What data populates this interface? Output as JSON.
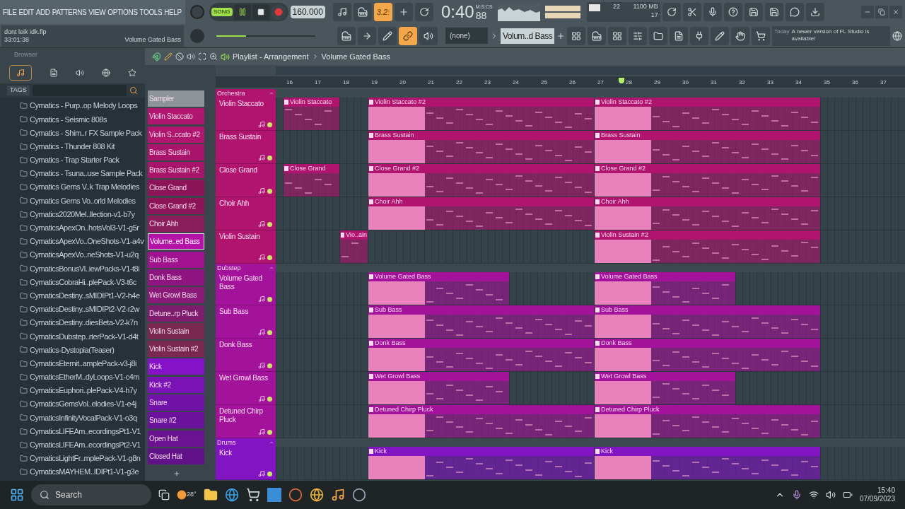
{
  "menu": [
    "FILE",
    "EDIT",
    "ADD",
    "PATTERNS",
    "VIEW",
    "OPTIONS",
    "TOOLS",
    "HELP"
  ],
  "project": {
    "file": "dont leik idk.flp",
    "duration": "33:01:38",
    "hint": "Volume Gated Bass"
  },
  "transport": {
    "mode_label": "SONG",
    "song_mode": true,
    "playing": true,
    "tempo": "160.000",
    "time": "0:40",
    "time_cs": "88",
    "time_unit": "M:S:CS"
  },
  "pitch_slider": {
    "level": 0.3
  },
  "countdown": {
    "label": "3.2:",
    "on": true
  },
  "link": {
    "on": true
  },
  "cpu": {
    "voices": "22",
    "memory": "1100 MB",
    "polyphony": "17"
  },
  "pattern": {
    "preset": "(none)",
    "name": "Volum..d Bass"
  },
  "news": {
    "when": "Today",
    "text": "A newer version of FL Studio is available!"
  },
  "browser": {
    "title": "Browser",
    "tags_label": "TAGS",
    "items": [
      "Cymatics - Purp..op Melody Loops",
      "Cymatics - Seismic 808s",
      "Cymatics - Shim..r FX Sample Pack",
      "Cymatics - Thunder 808 Kit",
      "Cymatics - Trap Starter Pack",
      "Cymatics - Tsuna..use Sample Pack",
      "Cymatics Gems V..k Trap Melodies",
      "Cymatics Gems Vo..orld Melodies",
      "Cymatics2020Mel..llection-v1-b7y",
      "CymaticsApexOn..hotsVol3-V1-g5r",
      "CymaticsApexVo..OneShots-V1-a4v",
      "CymaticsApexVo..neShots-V1-u2q",
      "CymaticsBonusVl..iewPacks-V1-t8i",
      "CymaticsCobraHi..plePack-V3-t6c",
      "CymaticsDestiny..sMIDIPt1-V2-h4e",
      "CymaticsDestiny..sMIDIPt2-V2-r2w",
      "CymaticsDestiny..diesBeta-V2-k7n",
      "CymaticsDubstep..rterPack-V1-d4t",
      "Cymatics-Dystopia(Teaser)",
      "CymaticsEternit..amplePack-v3-j8i",
      "CymaticsEtherM..dyLoops-V1-c4m",
      "CymaticsEuphori..plePack-V4-h7y",
      "CymaticsGemsVol..elodies-V1-e4j",
      "CymaticsInfinityVocalPack-V1-o3q",
      "CymaticsLIFEAm..ecordingsPt1-V1",
      "CymaticsLIFEAm..ecordingsPt2-V1",
      "CymaticsLightFr..mplePack-V1-g8n",
      "CymaticsMAYHEM..IDIPt1-V1-g3e"
    ]
  },
  "channels": [
    {
      "name": "Sampler",
      "color": "#8e9599",
      "selected": false
    },
    {
      "name": "Violin Staccato",
      "color": "#b0156f",
      "selected": false
    },
    {
      "name": "Violin S..ccato #2",
      "color": "#b0156f",
      "selected": false
    },
    {
      "name": "Brass Sustain",
      "color": "#a8146a",
      "selected": false
    },
    {
      "name": "Brass Sustain #2",
      "color": "#a8146a",
      "selected": false
    },
    {
      "name": "Close Grand",
      "color": "#8e1459",
      "selected": false
    },
    {
      "name": "Close Grand #2",
      "color": "#8e1459",
      "selected": false
    },
    {
      "name": "Choir Ahh",
      "color": "#8a1d5c",
      "selected": false
    },
    {
      "name": "Volume..ed Bass",
      "color": "#b512a8",
      "selected": true
    },
    {
      "name": "Sub Bass",
      "color": "#a0128f",
      "selected": false
    },
    {
      "name": "Donk Bass",
      "color": "#8e1480",
      "selected": false
    },
    {
      "name": "Wet Growl Bass",
      "color": "#8a1a78",
      "selected": false
    },
    {
      "name": "Detune..rp Pluck",
      "color": "#7e1c6e",
      "selected": false
    },
    {
      "name": "Violin Sustain",
      "color": "#7a2850",
      "selected": false
    },
    {
      "name": "Violin Sustain #2",
      "color": "#7a2850",
      "selected": false
    },
    {
      "name": "Kick",
      "color": "#8612c8",
      "selected": false
    },
    {
      "name": "Kick #2",
      "color": "#7a12b6",
      "selected": false
    },
    {
      "name": "Snare",
      "color": "#7212a8",
      "selected": false
    },
    {
      "name": "Snare #2",
      "color": "#6a129c",
      "selected": false
    },
    {
      "name": "Open Hat",
      "color": "#6a1290",
      "selected": false
    },
    {
      "name": "Closed Hat",
      "color": "#621288",
      "selected": false
    }
  ],
  "playlist": {
    "title": "Playlist - Arrangement",
    "pattern": "Volume Gated Bass",
    "ruler": [
      "16",
      "17",
      "18",
      "19",
      "20",
      "21",
      "22",
      "23",
      "24",
      "25",
      "26",
      "27",
      "28",
      "29",
      "30",
      "31",
      "32",
      "33",
      "34",
      "35",
      "36",
      "37"
    ],
    "groups": [
      {
        "name": "Orchestra",
        "color": "#b0146e",
        "tracks": [
          {
            "name": "Violin Staccato",
            "clips": [
              "Violin Staccato",
              "Violin Staccato #2",
              "Violin Staccato #2"
            ]
          },
          {
            "name": "Brass Sustain",
            "clips": [
              "Brass Sustain",
              "Brass Sustain"
            ]
          },
          {
            "name": "Close Grand",
            "clips": [
              "Close Grand",
              "Close Grand #2",
              "Close Grand #2"
            ]
          },
          {
            "name": "Choir Ahh",
            "clips": [
              "Choir Ahh",
              "Choir Ahh"
            ]
          },
          {
            "name": "Violin Sustain",
            "clips": [
              "Vio..ain",
              "Violin Sustain #2"
            ]
          }
        ]
      },
      {
        "name": "Dubstep",
        "color": "#a3129a",
        "tracks": [
          {
            "name": "Volume Gated Bass",
            "clips": [
              "Volume Gated Bass",
              "Volume Gated Bass"
            ]
          },
          {
            "name": "Sub Bass",
            "clips": [
              "Sub Bass",
              "Sub Bass"
            ]
          },
          {
            "name": "Donk Bass",
            "clips": [
              "Donk Bass",
              "Donk Bass"
            ]
          },
          {
            "name": "Wet Growl Bass",
            "clips": [
              "Wet Growl Bass",
              "Wet Growl Bass"
            ]
          },
          {
            "name": "Detuned Chirp Pluck",
            "clips": [
              "Detuned Chirp Pluck",
              "Detuned Chirp Pluck"
            ]
          }
        ]
      },
      {
        "name": "Drums",
        "color": "#8214c4",
        "tracks": [
          {
            "name": "Kick",
            "clips": [
              "Kick",
              "Kick"
            ]
          }
        ]
      }
    ]
  },
  "taskbar": {
    "search": "Search",
    "weather": "28°",
    "time": "15:40",
    "date": "07/09/2023"
  }
}
